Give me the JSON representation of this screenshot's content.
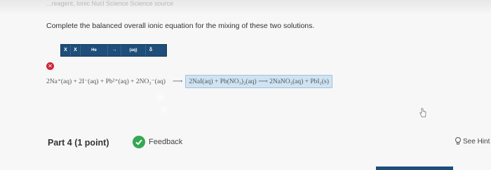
{
  "header": {
    "crumb": "...reagent, Ionic Nucl Science Science source"
  },
  "question": {
    "prompt": "Complete the balanced overall ionic equation for the mixing of these two solutions."
  },
  "toolbar": {
    "btn1": "X",
    "btn2": "X",
    "btn3": "He",
    "btn4": "→",
    "btn5": "(aq)",
    "btn6": "δ"
  },
  "status": {
    "incorrect_symbol": "✕"
  },
  "equation": {
    "reactants": "2Na⁺(aq) + 2I⁻(aq) + Pb²⁺(aq) + 2NO₃⁻(aq)",
    "arrow": "⟶",
    "answer_part1": "2NaI(aq) + Pb(NO₃)₂(aq)",
    "answer_arrow": "⟶",
    "answer_part2": "2NaNO₃(aq) + PbI₂(s)"
  },
  "footer": {
    "part_label": "Part 4  (1 point)",
    "feedback_label": "Feedback",
    "hint_label": "See Hint"
  },
  "colors": {
    "toolbar_bg": "#1e4e79",
    "answer_bg": "#cfe3f2",
    "incorrect": "#d0233a",
    "feedback_ok": "#34a853"
  }
}
